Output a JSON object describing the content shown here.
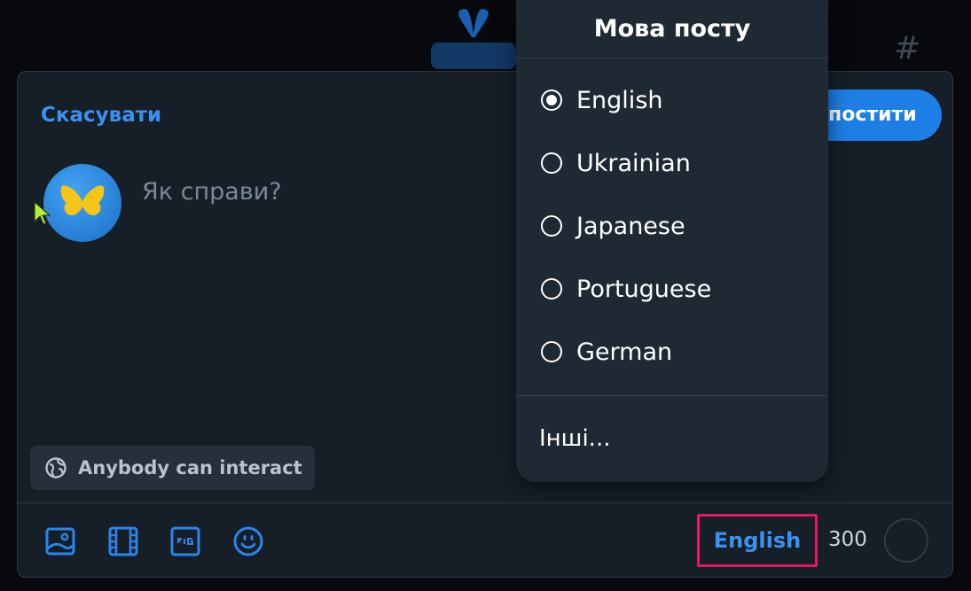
{
  "composer": {
    "cancel_label": "Скасувати",
    "post_label": "постити",
    "placeholder": "Як справи?",
    "threadgate_label": "Anybody can interact",
    "language_label": "English",
    "char_count": "300"
  },
  "language_menu": {
    "title": "Мова посту",
    "options": [
      {
        "label": "English",
        "selected": true
      },
      {
        "label": "Ukrainian",
        "selected": false
      },
      {
        "label": "Japanese",
        "selected": false
      },
      {
        "label": "Portuguese",
        "selected": false
      },
      {
        "label": "German",
        "selected": false
      }
    ],
    "other_label": "Інші..."
  },
  "colors": {
    "accent": "#1d7fe5",
    "link": "#3b91ee",
    "highlight": "#e8166b",
    "panel": "#161e27"
  },
  "icons": [
    "butterfly-icon",
    "hash-icon",
    "globe-icon",
    "image-icon",
    "video-icon",
    "gif-icon",
    "emoji-icon"
  ]
}
